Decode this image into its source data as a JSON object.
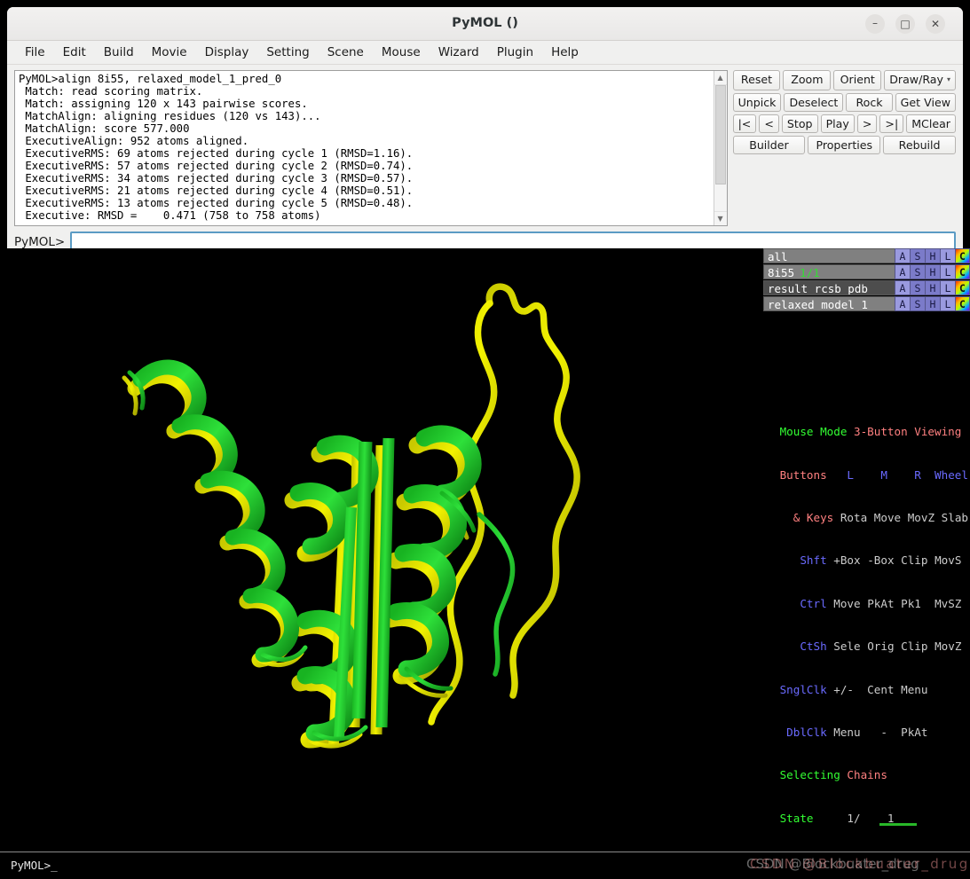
{
  "window": {
    "title": "PyMOL ()",
    "controls": {
      "minimize": "–",
      "maximize": "□",
      "close": "✕"
    }
  },
  "menubar": {
    "items": [
      {
        "label": "File"
      },
      {
        "label": "Edit"
      },
      {
        "label": "Build"
      },
      {
        "label": "Movie"
      },
      {
        "label": "Display"
      },
      {
        "label": "Setting"
      },
      {
        "label": "Scene"
      },
      {
        "label": "Mouse"
      },
      {
        "label": "Wizard"
      },
      {
        "label": "Plugin"
      },
      {
        "label": "Help"
      }
    ]
  },
  "console": {
    "text": "PyMOL>align 8i55, relaxed_model_1_pred_0\n Match: read scoring matrix.\n Match: assigning 120 x 143 pairwise scores.\n MatchAlign: aligning residues (120 vs 143)...\n MatchAlign: score 577.000\n ExecutiveAlign: 952 atoms aligned.\n ExecutiveRMS: 69 atoms rejected during cycle 1 (RMSD=1.16).\n ExecutiveRMS: 57 atoms rejected during cycle 2 (RMSD=0.74).\n ExecutiveRMS: 34 atoms rejected during cycle 3 (RMSD=0.57).\n ExecutiveRMS: 21 atoms rejected during cycle 4 (RMSD=0.51).\n ExecutiveRMS: 13 atoms rejected during cycle 5 (RMSD=0.48).\n Executive: RMSD =    0.471 (758 to 758 atoms)",
    "scroll_up_glyph": "▲",
    "scroll_down_glyph": "▼"
  },
  "buttons": {
    "row1": [
      {
        "label": "Reset"
      },
      {
        "label": "Zoom"
      },
      {
        "label": "Orient"
      },
      {
        "label": "Draw/Ray"
      }
    ],
    "row2": [
      {
        "label": "Unpick"
      },
      {
        "label": "Deselect"
      },
      {
        "label": "Rock"
      },
      {
        "label": "Get View"
      }
    ],
    "row3": [
      {
        "label": "|<"
      },
      {
        "label": "<"
      },
      {
        "label": "Stop"
      },
      {
        "label": "Play"
      },
      {
        "label": ">"
      },
      {
        "label": ">|"
      },
      {
        "label": "MClear"
      }
    ],
    "row4": [
      {
        "label": "Builder"
      },
      {
        "label": "Properties"
      },
      {
        "label": "Rebuild"
      }
    ]
  },
  "command_line": {
    "prompt": "PyMOL>",
    "value": "",
    "placeholder": ""
  },
  "object_panel": {
    "button_labels": [
      "A",
      "S",
      "H",
      "L",
      "C"
    ],
    "rows": [
      {
        "name": "all",
        "state": "",
        "dim": false
      },
      {
        "name": "8i55",
        "state": "1/1",
        "dim": false
      },
      {
        "name": "result_rcsb_pdb_",
        "state": "",
        "dim": true
      },
      {
        "name": "relaxed_model_1_",
        "state": "",
        "dim": false
      }
    ]
  },
  "mouse_legend": {
    "title_label": "Mouse Mode",
    "title_value": "3-Button Viewing",
    "header_left_1": "Buttons",
    "header_left_2": "& Keys",
    "col_l": "L",
    "col_m": "M",
    "col_r": "R",
    "col_wheel": "Wheel",
    "rows": [
      {
        "key": "",
        "l": "Rota",
        "m": "Move",
        "r": "MovZ",
        "w": "Slab"
      },
      {
        "key": "Shft",
        "l": "+Box",
        "m": "-Box",
        "r": "Clip",
        "w": "MovS"
      },
      {
        "key": "Ctrl",
        "l": "Move",
        "m": "PkAt",
        "r": "Pk1",
        "w": "MvSZ"
      },
      {
        "key": "CtSh",
        "l": "Sele",
        "m": "Orig",
        "r": "Clip",
        "w": "MovZ"
      },
      {
        "key": "SnglClk",
        "l": "+/-",
        "m": "Cent",
        "r": "Menu",
        "w": ""
      },
      {
        "key": "DblClk",
        "l": "Menu",
        "m": "-",
        "r": "PkAt",
        "w": ""
      }
    ],
    "selecting_label": "Selecting",
    "selecting_value": "Chains",
    "state_label": "State",
    "state_value": "1/    1"
  },
  "status_bar": {
    "prompt": "PyMOL>_",
    "watermark": "CSDN @Blockbuater_drug"
  },
  "colors": {
    "structure_green": "#20cc2a",
    "structure_yellow": "#e8e800",
    "viewport_background": "#000000",
    "accent_focus": "#5b9bc4",
    "legend_green": "#33ff33",
    "legend_salmon": "#ff8080",
    "legend_blue": "#6a6aff"
  }
}
